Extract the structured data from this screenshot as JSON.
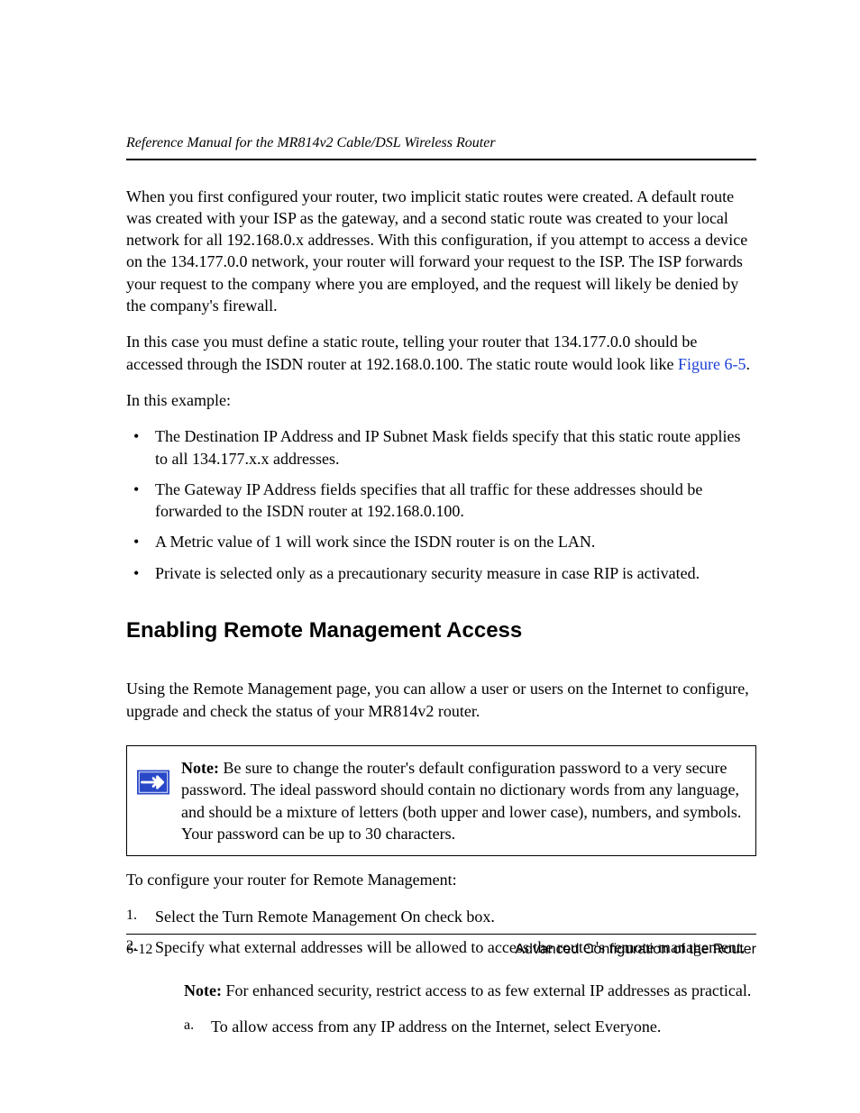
{
  "header": {
    "title": "Reference Manual for the MR814v2 Cable/DSL Wireless Router"
  },
  "body": {
    "p1": "When you first configured your router, two implicit static routes were created. A default route was created with your ISP as the gateway, and a second static route was created to your local network for all 192.168.0.x addresses. With this configuration, if you attempt to access a device on the 134.177.0.0 network, your router will forward your request to the ISP. The ISP forwards your request to the company where you are employed, and the request will likely be denied by the company's firewall.",
    "p2_pre": "In this case you must define a static route, telling your router that 134.177.0.0 should be accessed through the ISDN router at 192.168.0.100. The static route would look like ",
    "p2_link": "Figure 6-5",
    "p2_post": ".",
    "p3": "In this example:",
    "bullets": [
      "The Destination IP Address and IP Subnet Mask fields specify that this static route applies to all 134.177.x.x addresses.",
      "The Gateway IP Address fields specifies that all traffic for these addresses should be forwarded to the ISDN router at 192.168.0.100.",
      "A Metric value of 1 will work since the ISDN router is on the LAN.",
      "Private is selected only as a precautionary security measure in case RIP is activated."
    ],
    "heading": "Enabling Remote Management Access",
    "p4": "Using the Remote Management page, you can allow a user or users on the Internet to configure, upgrade and check the status of your MR814v2 router.",
    "note_label": "Note:",
    "note_body": " Be sure to change the router's default configuration password to a very secure password. The ideal password should contain no dictionary words from any language, and should be a mixture of letters (both upper and lower case), numbers, and symbols. Your password can be up to 30 characters.",
    "p5": "To configure your router for Remote Management:",
    "steps": [
      "Select the Turn Remote Management On check box.",
      "Specify what external addresses will be allowed to access the router's remote management."
    ],
    "step2_note_label": "Note:",
    "step2_note_body": " For enhanced security, restrict access to as few external IP addresses as practical.",
    "step2_sub": [
      "To allow access from any IP address on the Internet, select Everyone."
    ]
  },
  "footer": {
    "page": "6-12",
    "section": "Advanced Configuration of the Router"
  }
}
